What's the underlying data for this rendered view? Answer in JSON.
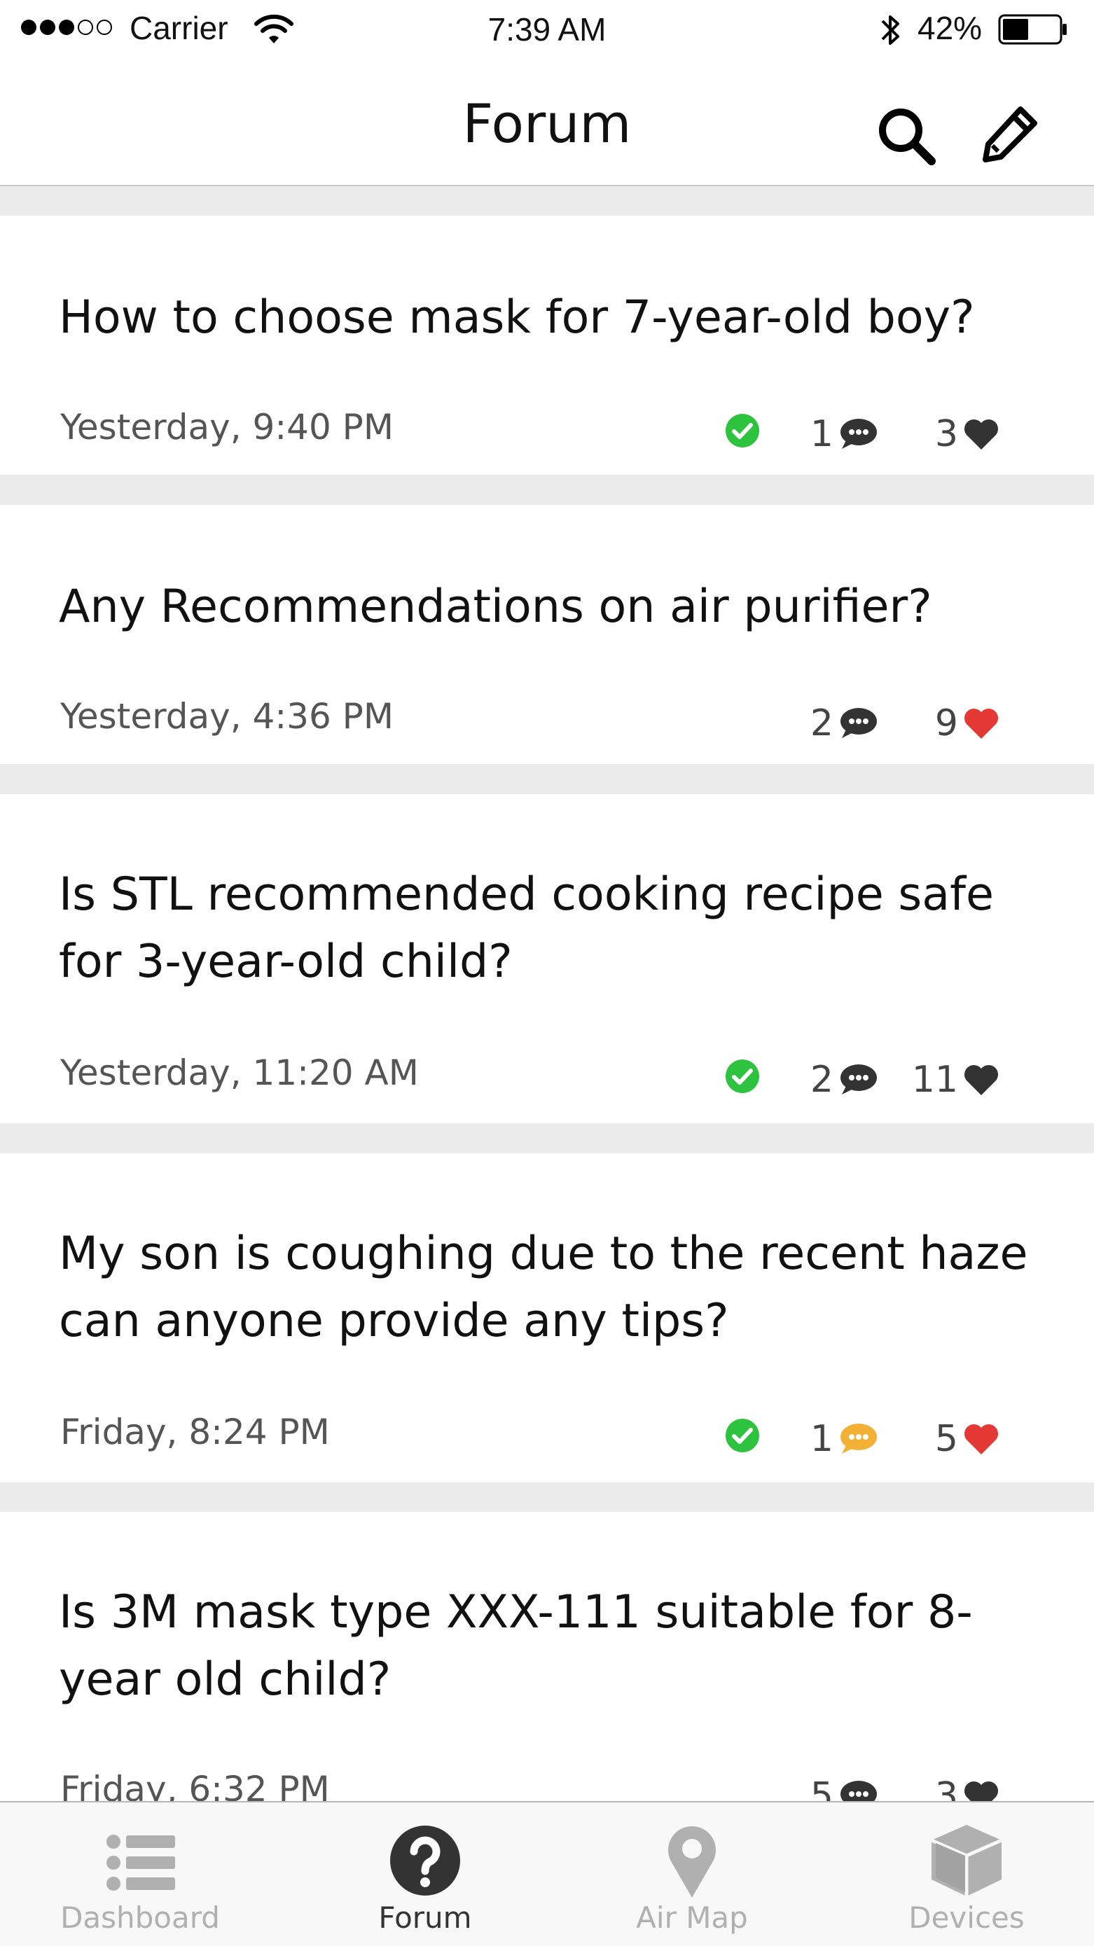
{
  "status_bar": {
    "carrier": "Carrier",
    "time": "7:39 AM",
    "battery": "42%"
  },
  "nav": {
    "title": "Forum",
    "icons": [
      "search-icon",
      "compose-icon"
    ]
  },
  "posts": [
    {
      "title": "How to choose mask for 7-year-old boy?",
      "date": "Yesterday, 9:40 PM",
      "answered": true,
      "comments": "1",
      "likes": "3",
      "comment_color": "#333333",
      "heart_color": "#333333"
    },
    {
      "title": "Any Recommendations on air purifier?",
      "date": "Yesterday, 4:36 PM",
      "answered": false,
      "comments": "2",
      "likes": "9",
      "comment_color": "#333333",
      "heart_color": "#e53935"
    },
    {
      "title": "Is STL recommended cooking recipe safe for 3-year-old child?",
      "date": "Yesterday, 11:20 AM",
      "answered": true,
      "comments": "2",
      "likes": "11",
      "comment_color": "#333333",
      "heart_color": "#333333"
    },
    {
      "title": "My son is coughing due to the recent haze can anyone provide any tips?",
      "date": "Friday, 8:24 PM",
      "answered": true,
      "comments": "1",
      "likes": "5",
      "comment_color": "#f2b134",
      "heart_color": "#e53935"
    },
    {
      "title": "Is 3M mask type XXX-111 suitable for 8-year old child?",
      "date": "Friday, 6:32 PM",
      "answered": false,
      "comments": "5",
      "likes": "3",
      "comment_color": "#333333",
      "heart_color": "#333333"
    }
  ],
  "colors": {
    "check": "#2ec33f",
    "inactive_tab": "#b0b0b0",
    "active_tab": "#333333"
  },
  "tabs": [
    {
      "label": "Dashboard",
      "icon": "list-icon",
      "active": false
    },
    {
      "label": "Forum",
      "icon": "question-icon",
      "active": true
    },
    {
      "label": "Air Map",
      "icon": "map-pin-icon",
      "active": false
    },
    {
      "label": "Devices",
      "icon": "box-icon",
      "active": false
    }
  ]
}
